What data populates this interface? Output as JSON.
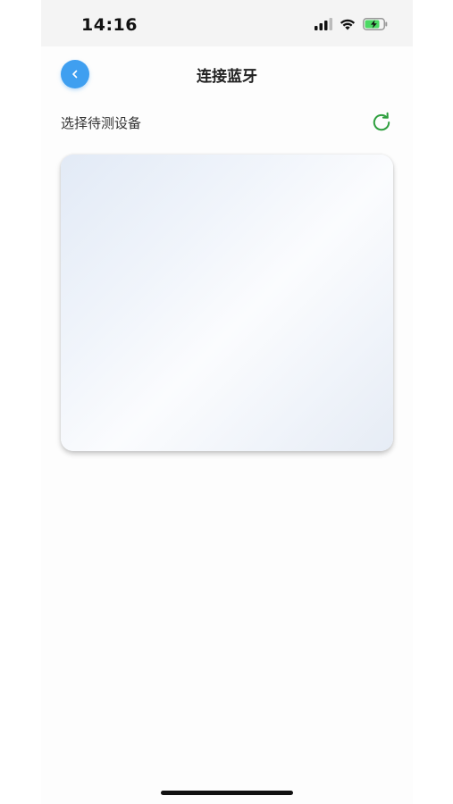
{
  "status_bar": {
    "time": "14:16"
  },
  "nav": {
    "title": "连接蓝牙",
    "back_icon": "chevron-left-icon"
  },
  "section": {
    "label": "选择待测设备",
    "refresh_icon": "refresh-icon"
  },
  "colors": {
    "accent": "#3f9ff0",
    "refresh": "#2e9f3e",
    "battery": "#4cd964"
  }
}
